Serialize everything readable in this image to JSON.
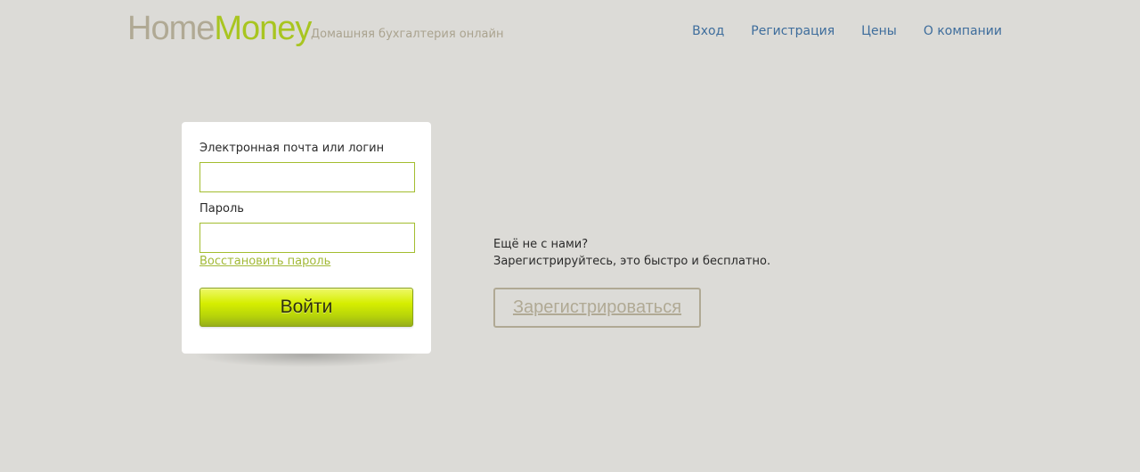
{
  "header": {
    "logo_home": "Home",
    "logo_money": "Money",
    "tagline": "Домашняя бухгалтерия онлайн",
    "nav": {
      "login": "Вход",
      "register": "Регистрация",
      "prices": "Цены",
      "about": "О компании"
    }
  },
  "login_form": {
    "email_label": "Электронная почта или логин",
    "email_value": "",
    "password_label": "Пароль",
    "password_value": "",
    "restore_link": "Восстановить пароль",
    "submit_label": "Войти"
  },
  "promo": {
    "line1": "Ещё не с нами?",
    "line2": "Зарегистрируйтесь, это быстро и бесплатно.",
    "register_button": "Зарегистрироваться"
  },
  "colors": {
    "background": "#dcdbd7",
    "accent_green": "#a8c520",
    "logo_gray": "#b0a994",
    "nav_blue": "#3e6d9c"
  }
}
